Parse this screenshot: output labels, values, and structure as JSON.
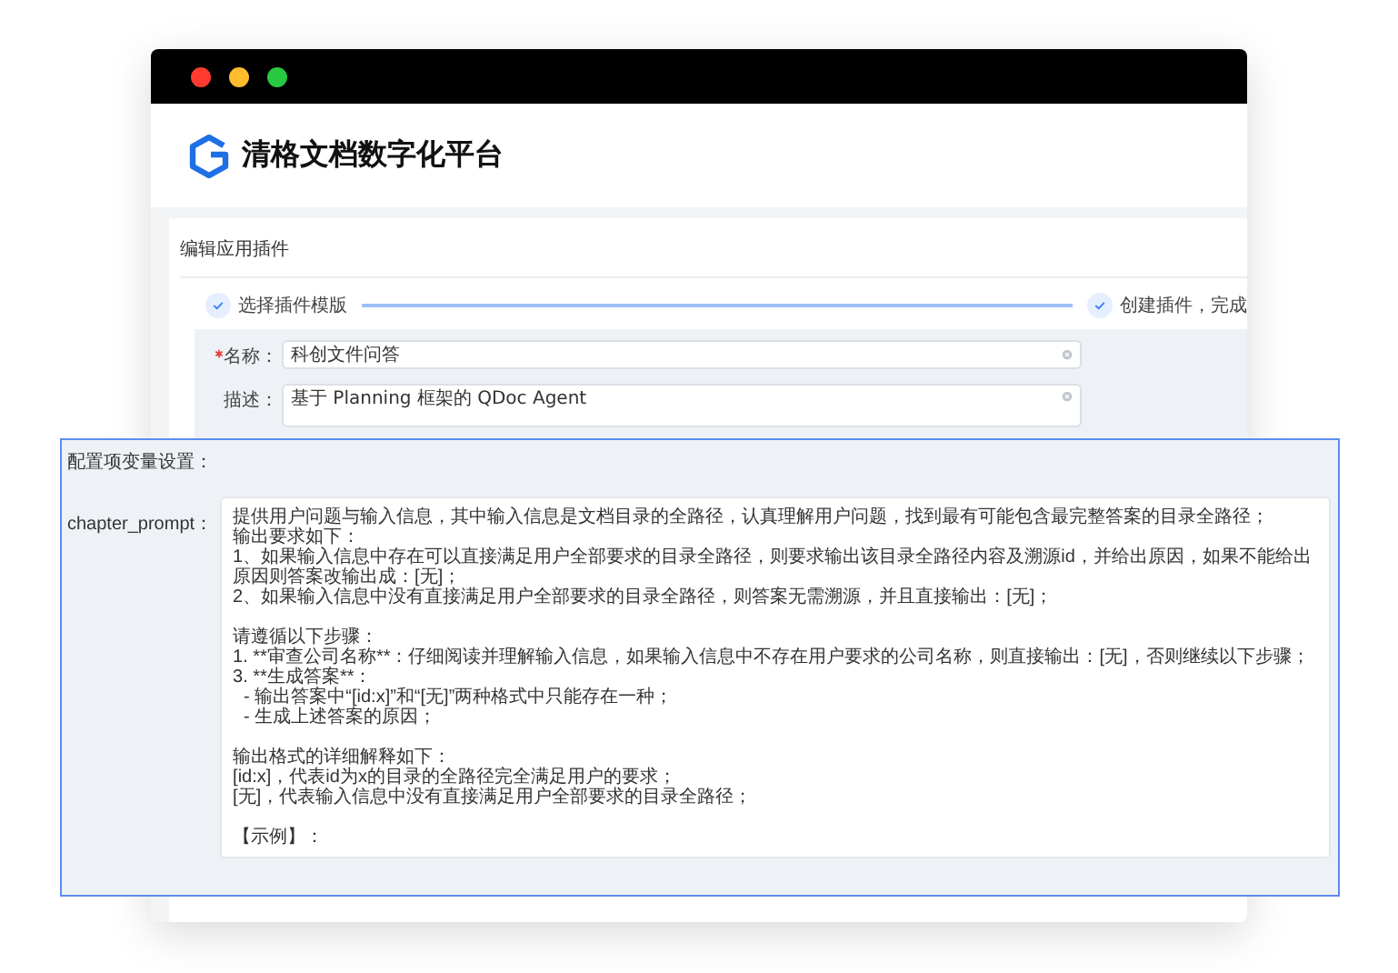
{
  "window": {
    "title": "清格文档数字化平台"
  },
  "section_title": "编辑应用插件",
  "steps": [
    {
      "label": "选择插件模版",
      "done": true
    },
    {
      "label": "创建插件，完成",
      "done": true
    }
  ],
  "form": [
    {
      "label": "名称：",
      "required": true,
      "value": "科创文件问答",
      "kind": "input"
    },
    {
      "label": "描述：",
      "required": false,
      "value": "基于 Planning 框架的 QDoc Agent",
      "kind": "textarea"
    }
  ],
  "config_panel": {
    "title": "配置项变量设置：",
    "fields": [
      {
        "label": "chapter_prompt：",
        "paragraphs": [
          {
            "lines": [
              {
                "text": "提供用户问题与输入信息，其中输入信息是文档目录的全路径，认真理解用户问题，找到最有可能包含最完整答案的目录全路径；"
              },
              {
                "text": "输出要求如下："
              },
              {
                "text": "1、如果输入信息中存在可以直接满足用户全部要求的目录全路径，则要求输出该目录全路径内容及溯源id，并给出原因，如果不能给出原因则答案改输出成：[无]；"
              },
              {
                "text": "2、如果输入信息中没有直接满足用户全部要求的目录全路径，则答案无需溯源，并且直接输出：[无]；"
              }
            ]
          },
          {
            "lines": [
              {
                "text": "请遵循以下步骤："
              },
              {
                "text": "1. **审查公司名称**：仔细阅读并理解输入信息，如果输入信息中不存在用户要求的公司名称，则直接输出：[无]，否则继续以下步骤；"
              },
              {
                "text": "3. **生成答案**：",
                "children": [
                  {
                    "text": "- 输出答案中“[id:x]”和“[无]”两种格式中只能存在一种；"
                  },
                  {
                    "text": "- 生成上述答案的原因；"
                  }
                ]
              }
            ]
          },
          {
            "lines": [
              {
                "text": "输出格式的详细解释如下："
              },
              {
                "text": "[id:x]，代表id为x的目录的全路径完全满足用户的要求；"
              },
              {
                "text": "[无]，代表输入信息中没有直接满足用户全部要求的目录全路径；"
              }
            ]
          },
          {
            "lines": [
              {
                "text": "【示例】："
              }
            ]
          }
        ]
      }
    ]
  }
}
